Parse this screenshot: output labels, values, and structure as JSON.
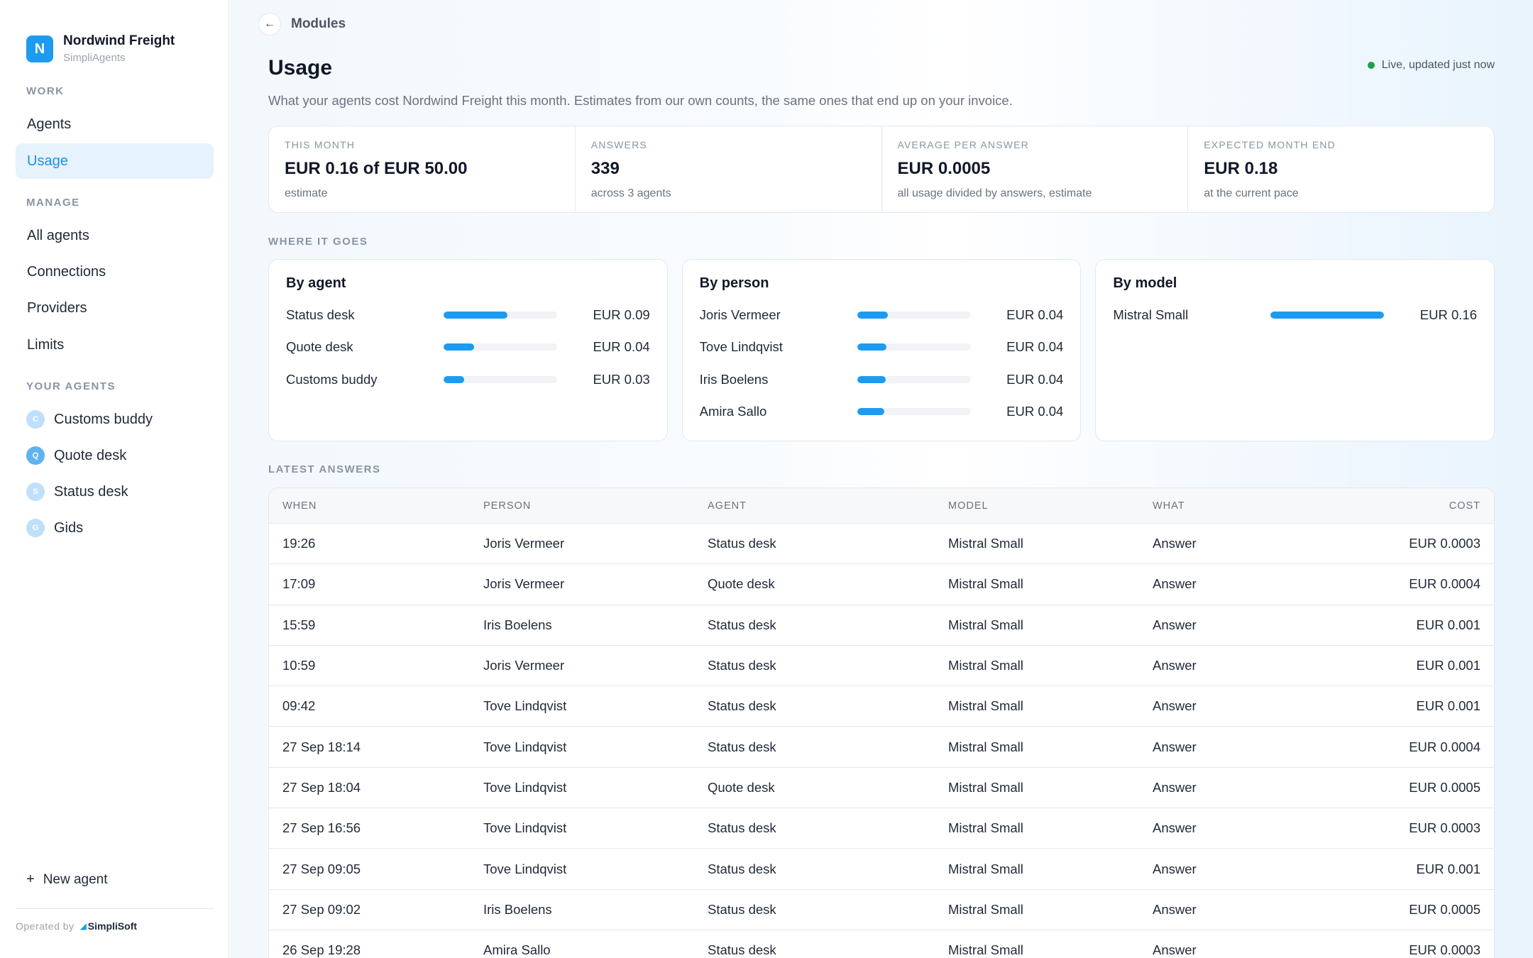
{
  "brand": {
    "initial": "N",
    "name": "Nordwind Freight",
    "sub": "SimpliAgents"
  },
  "sidebar": {
    "work_label": "WORK",
    "work_items": [
      {
        "label": "Agents"
      },
      {
        "label": "Usage",
        "active": true
      }
    ],
    "manage_label": "MANAGE",
    "manage_items": [
      {
        "label": "All agents"
      },
      {
        "label": "Connections"
      },
      {
        "label": "Providers"
      },
      {
        "label": "Limits"
      }
    ],
    "agents_label": "YOUR AGENTS",
    "agents": [
      {
        "initial": "C",
        "label": "Customs buddy",
        "color": "#bfe0fa"
      },
      {
        "initial": "Q",
        "label": "Quote desk",
        "color": "#5fb3ee"
      },
      {
        "initial": "S",
        "label": "Status desk",
        "color": "#bfe0fa"
      },
      {
        "initial": "G",
        "label": "Gids",
        "color": "#bfe0fa"
      }
    ],
    "new_agent": "New agent",
    "operated_by": "Operated by",
    "operator": "SimpliSoft"
  },
  "header": {
    "back_label": "Modules",
    "title": "Usage",
    "live": "Live, updated just now",
    "subtitle": "What your agents cost Nordwind Freight this month. Estimates from our own counts, the same ones that end up on your invoice."
  },
  "stats": [
    {
      "label": "THIS MONTH",
      "value": "EUR 0.16 of EUR 50.00",
      "note": "estimate"
    },
    {
      "label": "ANSWERS",
      "value": "339",
      "note": "across 3 agents"
    },
    {
      "label": "AVERAGE PER ANSWER",
      "value": "EUR 0.0005",
      "note": "all usage divided by answers, estimate"
    },
    {
      "label": "EXPECTED MONTH END",
      "value": "EUR 0.18",
      "note": "at the current pace"
    }
  ],
  "where_label": "WHERE IT GOES",
  "breakdowns": [
    {
      "title": "By agent",
      "rows": [
        {
          "label": "Status desk",
          "value": "EUR 0.09",
          "fraction": 0.56
        },
        {
          "label": "Quote desk",
          "value": "EUR 0.04",
          "fraction": 0.27
        },
        {
          "label": "Customs buddy",
          "value": "EUR 0.03",
          "fraction": 0.18
        }
      ]
    },
    {
      "title": "By person",
      "rows": [
        {
          "label": "Joris Vermeer",
          "value": "EUR 0.04",
          "fraction": 0.27
        },
        {
          "label": "Tove Lindqvist",
          "value": "EUR 0.04",
          "fraction": 0.26
        },
        {
          "label": "Iris Boelens",
          "value": "EUR 0.04",
          "fraction": 0.25
        },
        {
          "label": "Amira Sallo",
          "value": "EUR 0.04",
          "fraction": 0.24
        }
      ]
    },
    {
      "title": "By model",
      "rows": [
        {
          "label": "Mistral Small",
          "value": "EUR 0.16",
          "fraction": 1.0
        }
      ]
    }
  ],
  "latest_label": "LATEST ANSWERS",
  "table": {
    "columns": [
      "WHEN",
      "PERSON",
      "AGENT",
      "MODEL",
      "WHAT",
      "COST"
    ],
    "rows": [
      [
        "19:26",
        "Joris Vermeer",
        "Status desk",
        "Mistral Small",
        "Answer",
        "EUR 0.0003"
      ],
      [
        "17:09",
        "Joris Vermeer",
        "Quote desk",
        "Mistral Small",
        "Answer",
        "EUR 0.0004"
      ],
      [
        "15:59",
        "Iris Boelens",
        "Status desk",
        "Mistral Small",
        "Answer",
        "EUR 0.001"
      ],
      [
        "10:59",
        "Joris Vermeer",
        "Status desk",
        "Mistral Small",
        "Answer",
        "EUR 0.001"
      ],
      [
        "09:42",
        "Tove Lindqvist",
        "Status desk",
        "Mistral Small",
        "Answer",
        "EUR 0.001"
      ],
      [
        "27 Sep 18:14",
        "Tove Lindqvist",
        "Status desk",
        "Mistral Small",
        "Answer",
        "EUR 0.0004"
      ],
      [
        "27 Sep 18:04",
        "Tove Lindqvist",
        "Quote desk",
        "Mistral Small",
        "Answer",
        "EUR 0.0005"
      ],
      [
        "27 Sep 16:56",
        "Tove Lindqvist",
        "Status desk",
        "Mistral Small",
        "Answer",
        "EUR 0.0003"
      ],
      [
        "27 Sep 09:05",
        "Tove Lindqvist",
        "Status desk",
        "Mistral Small",
        "Answer",
        "EUR 0.001"
      ],
      [
        "27 Sep 09:02",
        "Iris Boelens",
        "Status desk",
        "Mistral Small",
        "Answer",
        "EUR 0.0005"
      ],
      [
        "26 Sep 19:28",
        "Amira Sallo",
        "Status desk",
        "Mistral Small",
        "Answer",
        "EUR 0.0003"
      ]
    ]
  }
}
